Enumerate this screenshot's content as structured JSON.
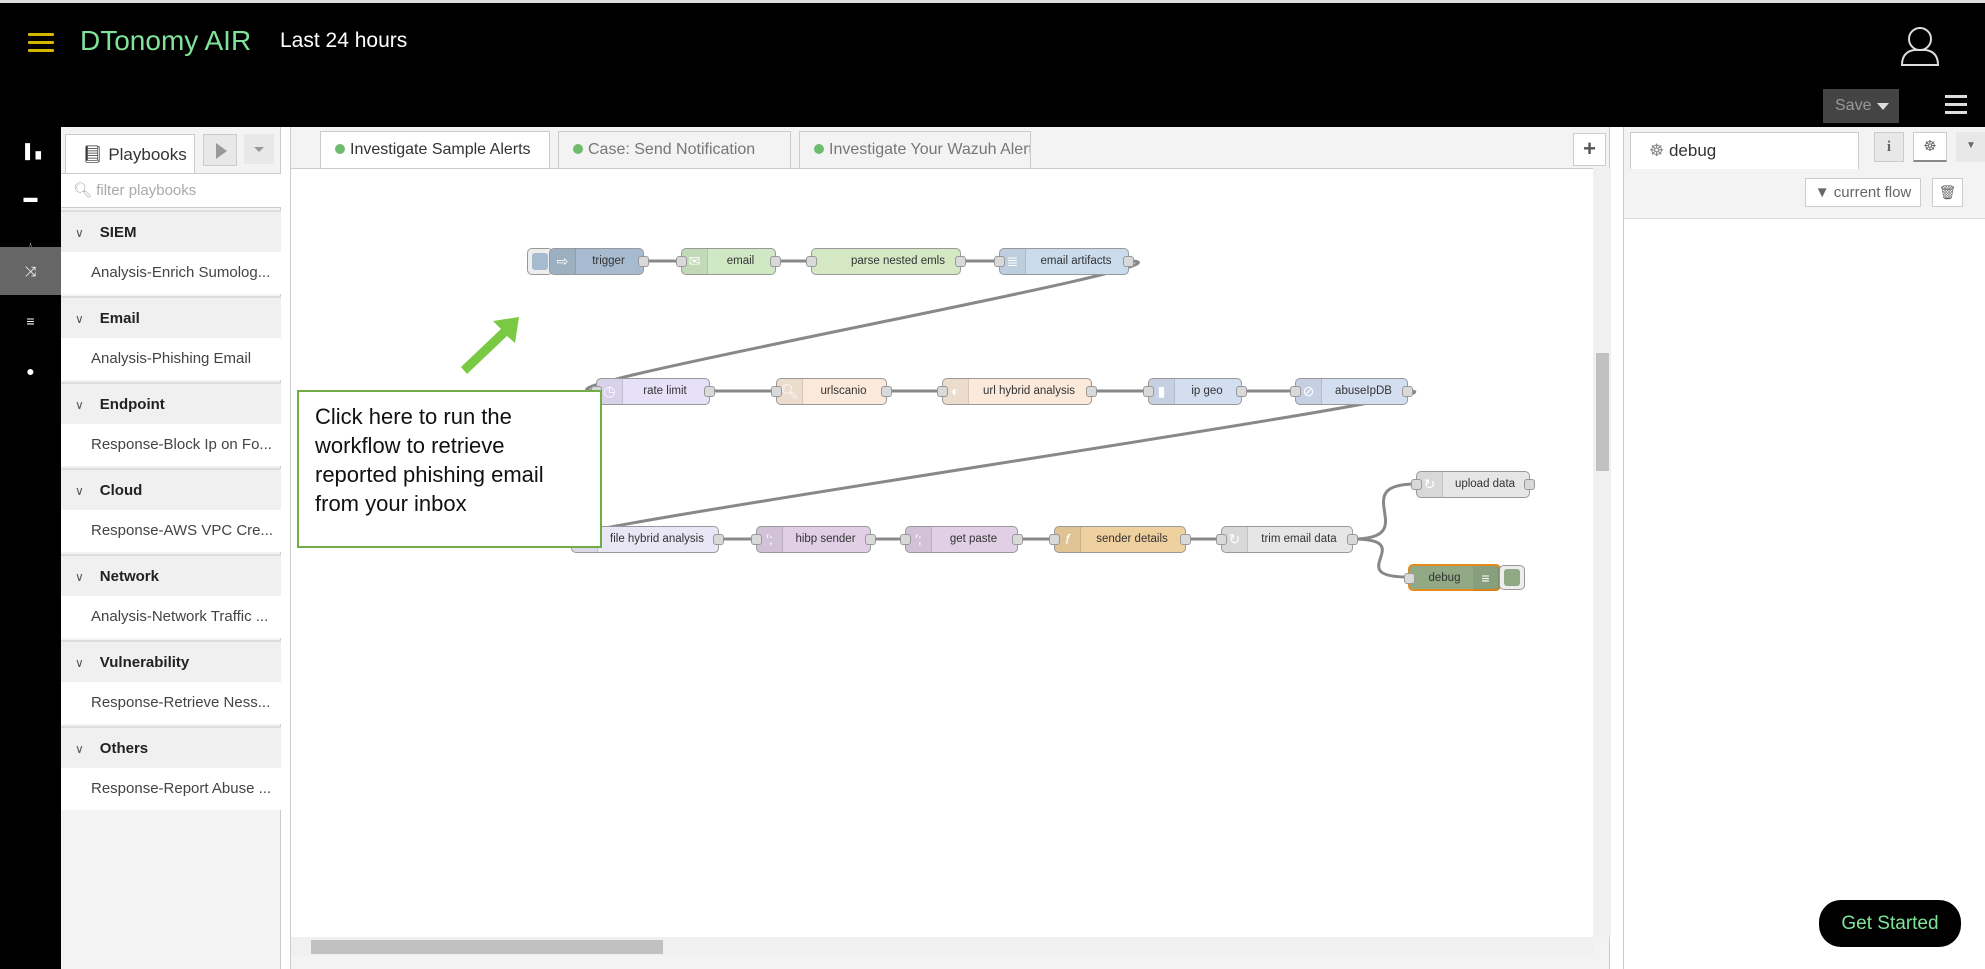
{
  "header": {
    "brand": "DTonomy AIR",
    "time_range": "Last 24 hours",
    "save_label": "Save",
    "brand_color": "#7fe39a"
  },
  "leftnav": {
    "items": [
      {
        "icon": "bar-chart-icon"
      },
      {
        "icon": "folder-icon"
      },
      {
        "icon": "drop-icon"
      },
      {
        "icon": "shuffle-icon",
        "active": true
      },
      {
        "icon": "sliders-icon"
      },
      {
        "icon": "help-icon"
      }
    ]
  },
  "playbooks": {
    "tab_label": "Playbooks",
    "filter_placeholder": "filter playbooks",
    "categories": [
      {
        "name": "SIEM",
        "items": [
          "Analysis-Enrich Sumolog..."
        ]
      },
      {
        "name": "Email",
        "items": [
          "Analysis-Phishing Email"
        ]
      },
      {
        "name": "Endpoint",
        "items": [
          "Response-Block Ip on Fo..."
        ]
      },
      {
        "name": "Cloud",
        "items": [
          "Response-AWS VPC Cre..."
        ]
      },
      {
        "name": "Network",
        "items": [
          "Analysis-Network Traffic ..."
        ]
      },
      {
        "name": "Vulnerability",
        "items": [
          "Response-Retrieve Ness..."
        ]
      },
      {
        "name": "Others",
        "items": [
          "Response-Report Abuse ..."
        ]
      }
    ]
  },
  "workspace": {
    "tabs": [
      {
        "label": "Investigate Sample Alerts",
        "active": true
      },
      {
        "label": "Case: Send Notification"
      },
      {
        "label": "Investigate Your Wazuh Alerts"
      }
    ],
    "nodes": [
      {
        "label": "trigger",
        "color": "#a6bbcf",
        "icon": "arrow-icon"
      },
      {
        "label": "email",
        "color": "#d0e8c4",
        "icon": "envelope-icon"
      },
      {
        "label": "parse nested emls",
        "color": "#d3e8c3",
        "icon": ""
      },
      {
        "label": "email artifacts",
        "color": "#c9dbec",
        "icon": "parser-icon"
      },
      {
        "label": "rate limit",
        "color": "#e6e0f8",
        "icon": "timer-icon"
      },
      {
        "label": "urlscanio",
        "color": "#fbeadb",
        "icon": "magnifier-icon"
      },
      {
        "label": "url hybrid analysis",
        "color": "#fbeadb",
        "icon": "hybrid-analysis-icon"
      },
      {
        "label": "ip geo",
        "color": "#d3def1",
        "icon": "database-icon"
      },
      {
        "label": "abuseIpDB",
        "color": "#d3def1",
        "icon": "abuseipdb-icon"
      },
      {
        "label": "file hybrid analysis",
        "color": "#e9e6f6",
        "icon": "hybrid-analysis-icon"
      },
      {
        "label": "hibp sender",
        "color": "#e0cfe5",
        "icon": "terminal-icon"
      },
      {
        "label": "get paste",
        "color": "#e0cfe5",
        "icon": "terminal-icon"
      },
      {
        "label": "sender details",
        "color": "#efd09f",
        "icon": "function-icon"
      },
      {
        "label": "trim email data",
        "color": "#e6e6e6",
        "icon": "trim-icon"
      },
      {
        "label": "upload data",
        "color": "#e6e6e6",
        "icon": "upload-icon"
      },
      {
        "label": "debug",
        "color": "#91a985",
        "icon": "debug-list-icon"
      }
    ],
    "callout": "Click here to run the workflow to retrieve reported phishing email from your inbox",
    "callout_color": "#70ad47"
  },
  "right_panel": {
    "tab_label": "debug",
    "filter_label": "current flow",
    "get_started": "Get Started"
  }
}
